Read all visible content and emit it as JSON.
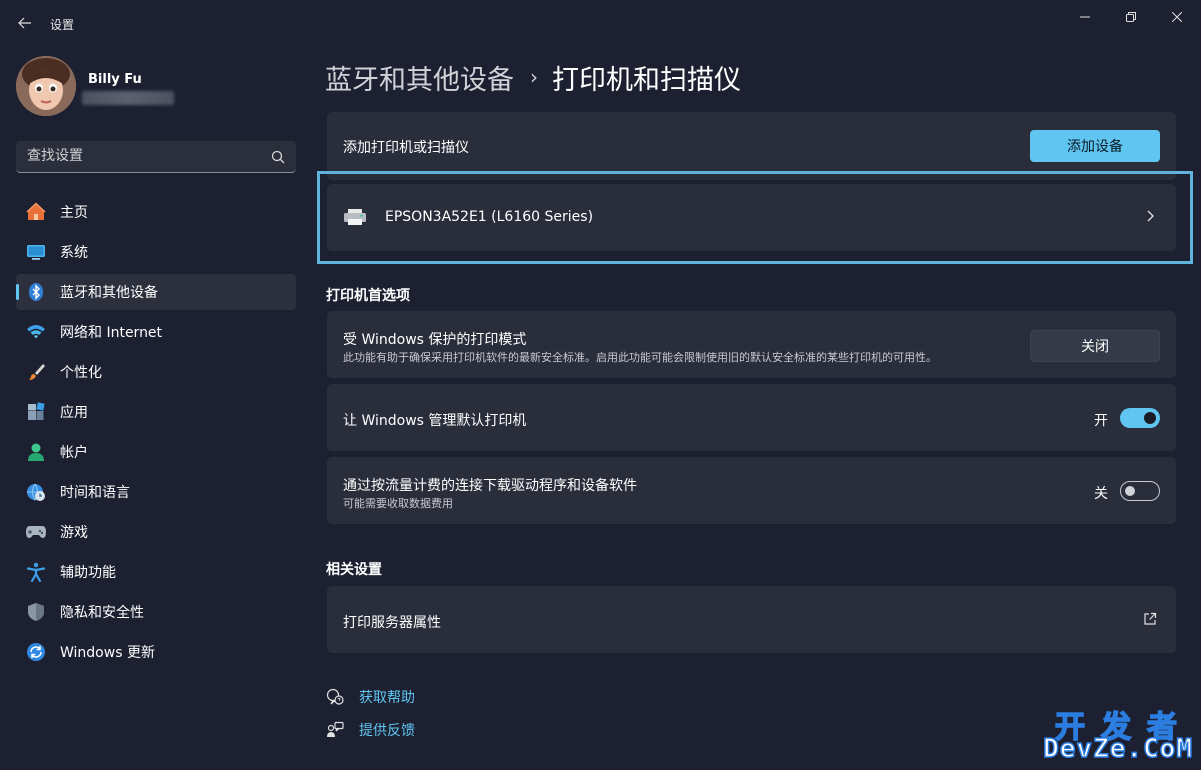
{
  "window": {
    "title": "设置"
  },
  "profile": {
    "name": "Billy Fu"
  },
  "search": {
    "placeholder": "查找设置"
  },
  "sidebar": {
    "items": [
      {
        "label": "主页",
        "icon": "home-icon"
      },
      {
        "label": "系统",
        "icon": "system-icon"
      },
      {
        "label": "蓝牙和其他设备",
        "icon": "bluetooth-icon",
        "active": true
      },
      {
        "label": "网络和 Internet",
        "icon": "wifi-icon"
      },
      {
        "label": "个性化",
        "icon": "brush-icon"
      },
      {
        "label": "应用",
        "icon": "apps-icon"
      },
      {
        "label": "帐户",
        "icon": "account-icon"
      },
      {
        "label": "时间和语言",
        "icon": "globe-clock-icon"
      },
      {
        "label": "游戏",
        "icon": "gamepad-icon"
      },
      {
        "label": "辅助功能",
        "icon": "accessibility-icon"
      },
      {
        "label": "隐私和安全性",
        "icon": "shield-icon"
      },
      {
        "label": "Windows 更新",
        "icon": "update-icon"
      }
    ]
  },
  "breadcrumb": {
    "parent": "蓝牙和其他设备",
    "separator": "›",
    "current": "打印机和扫描仪"
  },
  "add_printer": {
    "label": "添加打印机或扫描仪",
    "button": "添加设备"
  },
  "device": {
    "name": "EPSON3A52E1 (L6160 Series)"
  },
  "printer_prefs": {
    "title": "打印机首选项",
    "protected_mode": {
      "label": "受 Windows 保护的打印模式",
      "description": "此功能有助于确保采用打印机软件的最新安全标准。启用此功能可能会限制使用旧的默认安全标准的某些打印机的可用性。",
      "button": "关闭"
    },
    "manage_default": {
      "label": "让 Windows 管理默认打印机",
      "state_text": "开",
      "on": true
    },
    "metered_download": {
      "label": "通过按流量计费的连接下载驱动程序和设备软件",
      "description": "可能需要收取数据费用",
      "state_text": "关",
      "on": false
    }
  },
  "related": {
    "title": "相关设置",
    "print_server": "打印服务器属性"
  },
  "links": {
    "help": "获取帮助",
    "feedback": "提供反馈"
  },
  "watermark": {
    "line1": "开发者",
    "line2": "DevZe.CoM"
  },
  "colors": {
    "accent": "#60c5f1",
    "background": "#1c2030",
    "card": "#2a2e3b",
    "highlight": "#60b3dc"
  }
}
